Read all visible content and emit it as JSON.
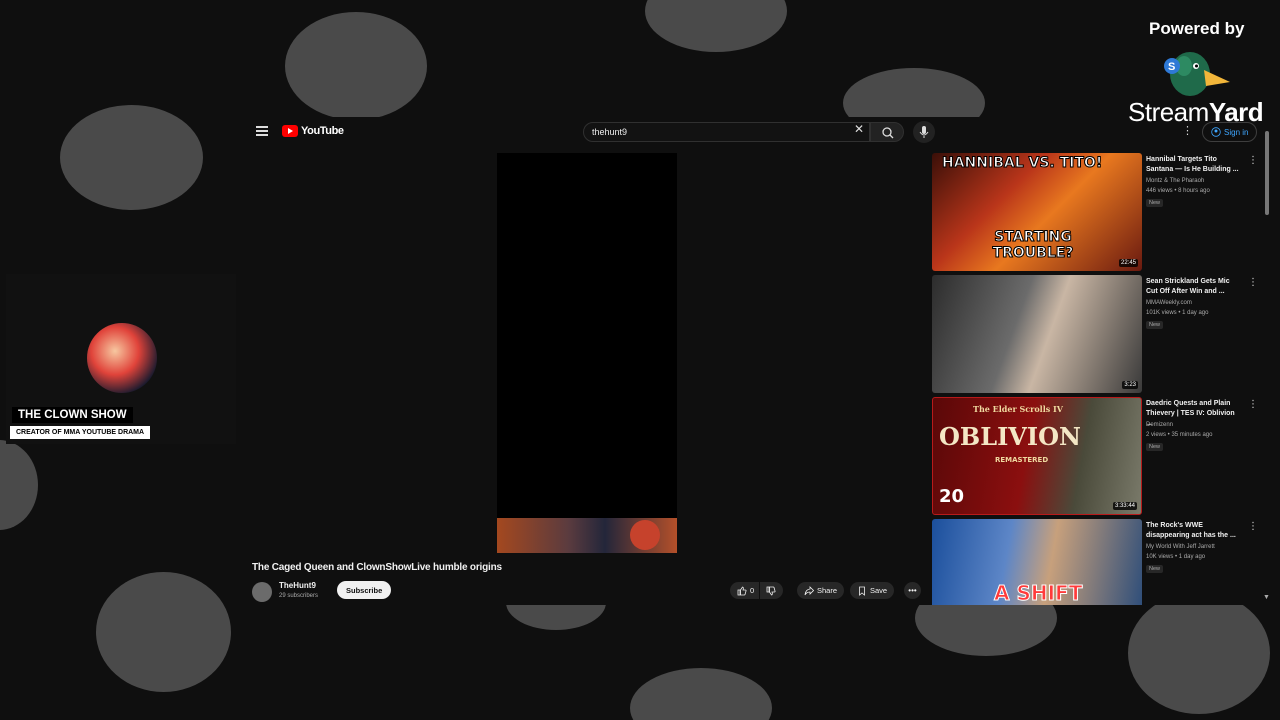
{
  "youtube": {
    "brand": "YouTube",
    "search": {
      "value": "thehunt9"
    },
    "sign_in": "Sign in"
  },
  "video": {
    "title": "The Caged Queen and ClownShowLive humble origins",
    "channel": "TheHunt9",
    "subscribers": "29 subscribers",
    "subscribe_label": "Subscribe",
    "likes": "0",
    "share_label": "Share",
    "save_label": "Save"
  },
  "recommendations": [
    {
      "title": "Hannibal Targets Tito Santana — Is He Building ...",
      "channel": "Montz & The Pharaoh",
      "meta": "446 views • 8 hours ago",
      "badge": "New",
      "duration": "22:45",
      "thumb_text": [
        "HANNIBAL VS. TITO!",
        "STARTING TROUBLE?"
      ]
    },
    {
      "title": "Sean Strickland Gets Mic Cut Off After Win and ...",
      "channel": "MMAWeekly.com",
      "meta": "101K views • 1 day ago",
      "badge": "New",
      "duration": "3:23",
      "thumb_text": []
    },
    {
      "title": "Daedric Quests and Plain Thievery | TES IV: Oblivion ...",
      "channel": "Demizenn",
      "meta": "2 views • 35 minutes ago",
      "badge": "New",
      "duration": "3:33:44",
      "thumb_text": [
        "OBLIVION",
        "20",
        "The Elder Scrolls IV",
        "REMASTERED"
      ]
    },
    {
      "title": "The Rock's WWE disappearing act has the ...",
      "channel": "My World With Jeff Jarrett",
      "meta": "10K views • 1 day ago",
      "badge": "New",
      "duration": "",
      "thumb_text": [
        "A SHIFT"
      ]
    }
  ],
  "overlay": {
    "show_name": "THE CLOWN SHOW",
    "show_subtitle": "CREATOR OF MMA YOUTUBE DRAMA",
    "powered_by": "Powered by",
    "streamyard_a": "Stream",
    "streamyard_b": "Yard"
  },
  "colors": {
    "background": "#0f0f0f",
    "blobs": "#4a4a4a",
    "youtube_red": "#ff0000",
    "link_blue": "#3ea6ff"
  }
}
